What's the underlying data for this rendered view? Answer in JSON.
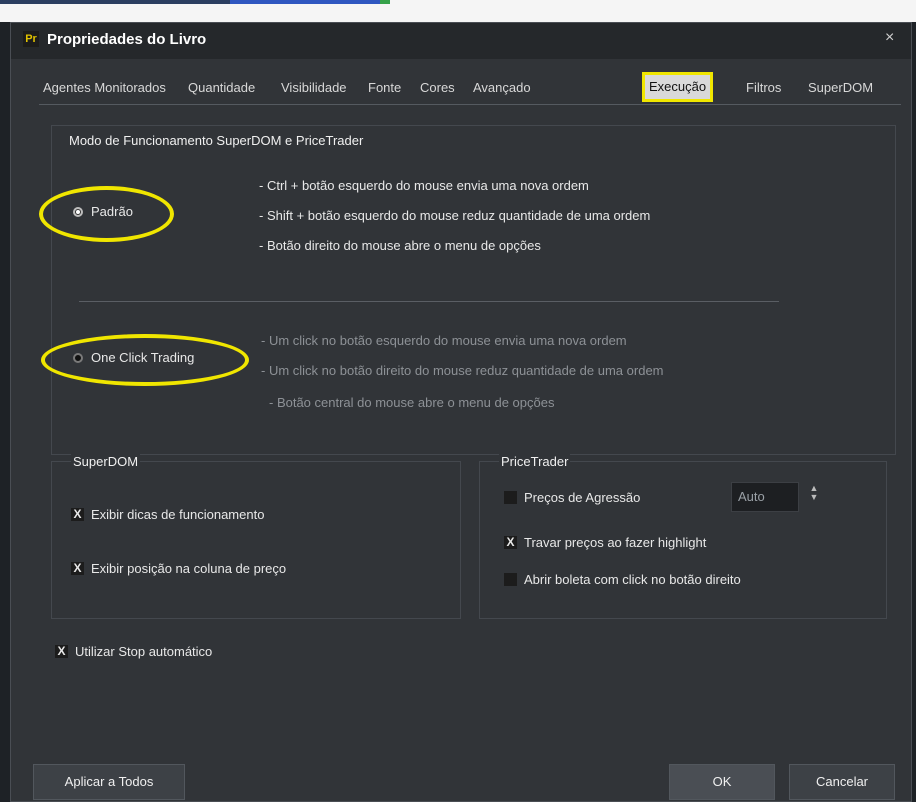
{
  "window": {
    "app_icon": "Pr",
    "title": "Propriedades do Livro",
    "close_icon": "×"
  },
  "tabs": [
    {
      "label": "Agentes Monitorados"
    },
    {
      "label": "Quantidade"
    },
    {
      "label": "Visibilidade"
    },
    {
      "label": "Fonte"
    },
    {
      "label": "Cores"
    },
    {
      "label": "Avançado"
    },
    {
      "label": "Execução",
      "active": true
    },
    {
      "label": "Filtros"
    },
    {
      "label": "SuperDOM"
    }
  ],
  "mode_section": {
    "title": "Modo de Funcionamento SuperDOM e PriceTrader",
    "padrao": {
      "label": "Padrão",
      "selected": true,
      "descriptions": [
        "- Ctrl + botão esquerdo do mouse envia uma nova ordem",
        "- Shift + botão esquerdo do mouse reduz quantidade de uma ordem",
        "- Botão direito do mouse abre o menu de opções"
      ]
    },
    "one_click": {
      "label": "One Click Trading",
      "selected": false,
      "descriptions": [
        "- Um click no botão esquerdo do mouse envia uma nova ordem",
        "- Um click no botão direito do mouse reduz quantidade de uma ordem",
        "- Botão central do mouse abre o menu de opções"
      ]
    }
  },
  "superdom": {
    "title": "SuperDOM",
    "options": [
      {
        "label": "Exibir dicas de funcionamento",
        "checked": true
      },
      {
        "label": "Exibir posição na coluna de preço",
        "checked": true
      }
    ]
  },
  "pricetrader": {
    "title": "PriceTrader",
    "options": [
      {
        "label": "Preços de Agressão",
        "checked": false
      },
      {
        "label": "Travar preços ao fazer highlight",
        "checked": true
      },
      {
        "label": "Abrir boleta com click no botão direito",
        "checked": false
      }
    ],
    "aggression_value": "Auto"
  },
  "auto_stop": {
    "label": "Utilizar Stop automático",
    "checked": true
  },
  "check_mark": "X",
  "buttons": {
    "apply_all": "Aplicar a Todos",
    "ok": "OK",
    "cancel": "Cancelar"
  },
  "colors": {
    "highlight": "#f0e600",
    "background": "#313438"
  }
}
